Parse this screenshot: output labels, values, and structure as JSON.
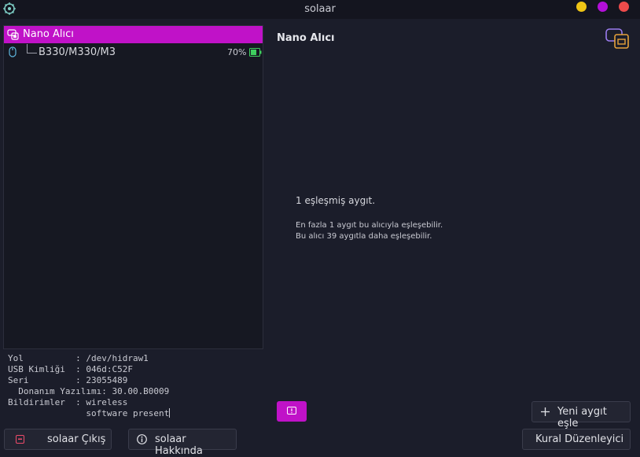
{
  "window": {
    "title": "solaar",
    "app_icon": "solaar-gear-icon",
    "controls": [
      "minimize",
      "maximize",
      "close"
    ],
    "colors": {
      "minimize": "#f0c515",
      "maximize": "#b40fd9",
      "close": "#ee4b4b"
    }
  },
  "tree": {
    "receiver": {
      "label": "Nano Alıcı",
      "icon": "receiver-icon",
      "selected": true,
      "highlight_color": "#c012c8"
    },
    "devices": [
      {
        "label": "B330/M330/M3",
        "icon": "mouse-icon",
        "battery": "70%",
        "battery_level": 0.7,
        "battery_icon": "battery-icon"
      }
    ]
  },
  "info": {
    "lines": [
      "Yol          : /dev/hidraw1",
      "USB Kimliği  : 046d:C52F",
      "Seri         : 23055489",
      "  Donanım Yazılımı: 30.00.B0009",
      "Bildirimler  : wireless",
      "               software present"
    ]
  },
  "buttons": {
    "quit": "solaar Çıkış",
    "about": "solaar Hakkında",
    "pair": "Yeni aygıt eşle",
    "rules": "Kural Düzenleyici"
  },
  "details": {
    "title": "Nano Alıcı",
    "paired_count": "1 eşleşmiş aygıt.",
    "pair_info_1": "En fazla 1 aygıt bu alıcıyla eşleşebilir.",
    "pair_info_2": "Bu alıcı 39 aygıtla daha eşleşebilir."
  },
  "colors": {
    "accent": "#c012c8",
    "background": "#1b1d2a",
    "battery": "#3fcf5f"
  }
}
